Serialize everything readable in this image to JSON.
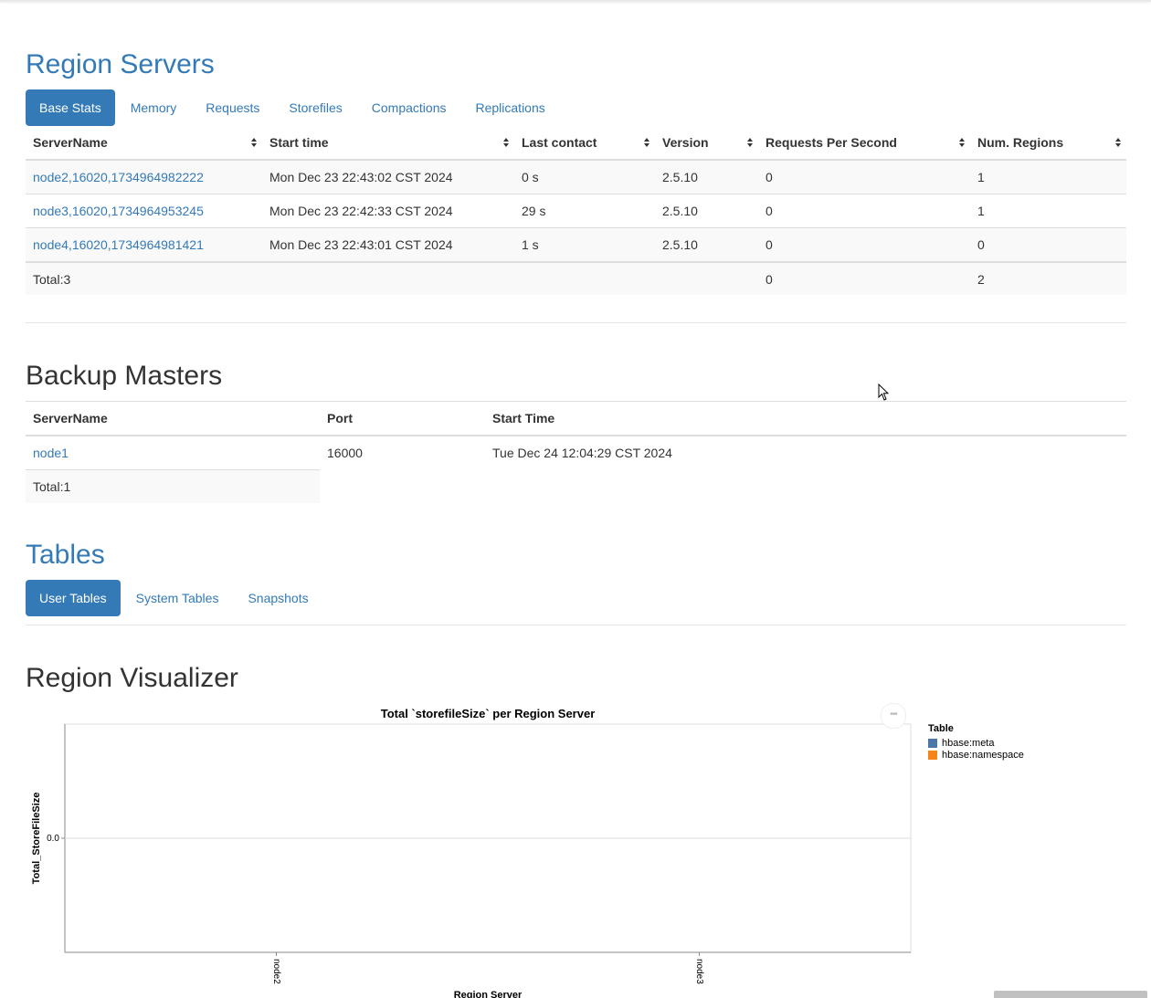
{
  "region_servers": {
    "title": "Region Servers",
    "tabs": [
      "Base Stats",
      "Memory",
      "Requests",
      "Storefiles",
      "Compactions",
      "Replications"
    ],
    "columns": [
      "ServerName",
      "Start time",
      "Last contact",
      "Version",
      "Requests Per Second",
      "Num. Regions"
    ],
    "rows": [
      [
        "node2,16020,1734964982222",
        "Mon Dec 23 22:43:02 CST 2024",
        "0 s",
        "2.5.10",
        "0",
        "1"
      ],
      [
        "node3,16020,1734964953245",
        "Mon Dec 23 22:42:33 CST 2024",
        "29 s",
        "2.5.10",
        "0",
        "1"
      ],
      [
        "node4,16020,1734964981421",
        "Mon Dec 23 22:43:01 CST 2024",
        "1 s",
        "2.5.10",
        "0",
        "0"
      ]
    ],
    "total": {
      "label": "Total:3",
      "requests": "0",
      "regions": "2"
    }
  },
  "backup_masters": {
    "title": "Backup Masters",
    "columns": [
      "ServerName",
      "Port",
      "Start Time"
    ],
    "rows": [
      [
        "node1",
        "16000",
        "Tue Dec 24 12:04:29 CST 2024"
      ]
    ],
    "total": "Total:1"
  },
  "tables": {
    "title": "Tables",
    "tabs": [
      "User Tables",
      "System Tables",
      "Snapshots"
    ]
  },
  "region_visualizer": {
    "title": "Region Visualizer"
  },
  "chart_data": {
    "type": "bar",
    "title": "Total `storefileSize` per Region Server",
    "xlabel": "Region Server",
    "ylabel": "Total_StoreFileSize",
    "categories": [
      "node2",
      "node3"
    ],
    "y_ticks": [
      "0.0"
    ],
    "ylim": [
      -1,
      1
    ],
    "series": [
      {
        "name": "hbase:meta",
        "values": [
          0,
          0
        ],
        "color": "#4c78a8"
      },
      {
        "name": "hbase:namespace",
        "values": [
          0,
          0
        ],
        "color": "#f58518"
      }
    ],
    "legend_title": "Table",
    "legend_position": "right",
    "grid": true
  },
  "colors": {
    "accent": "#337ab7",
    "text": "#333333",
    "border": "#dddddd",
    "stripe": "#f9f9f9"
  },
  "icons": {
    "sort": "sort-both-icon",
    "menu": "ellipsis-icon",
    "cursor": "mouse-pointer-icon"
  }
}
